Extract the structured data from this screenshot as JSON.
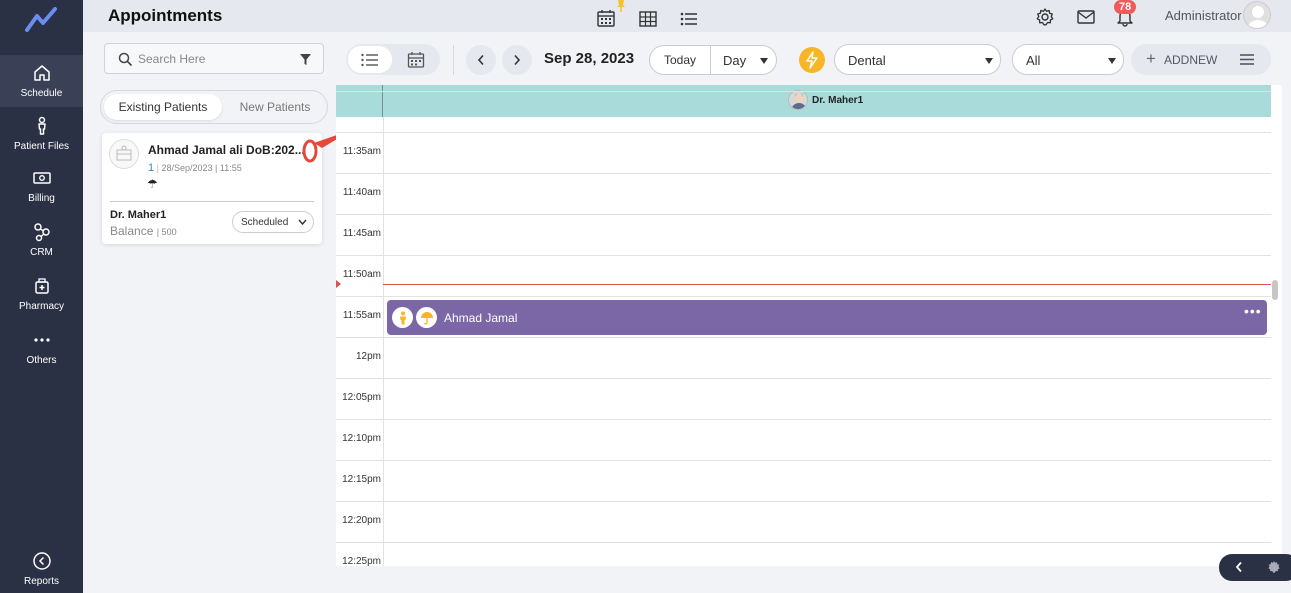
{
  "sidebar": {
    "items": [
      {
        "label": "Schedule",
        "icon": "home-icon",
        "active": true
      },
      {
        "label": "Patient Files",
        "icon": "person-icon"
      },
      {
        "label": "Billing",
        "icon": "money-icon"
      },
      {
        "label": "CRM",
        "icon": "crm-icon"
      },
      {
        "label": "Pharmacy",
        "icon": "pharmacy-icon"
      },
      {
        "label": "Others",
        "icon": "more-icon"
      }
    ],
    "reports_label": "Reports"
  },
  "header": {
    "title": "Appointments",
    "notification_count": "78",
    "user_name": "Administrator"
  },
  "left_panel": {
    "search_placeholder": "Search Here",
    "tabs": [
      "Existing Patients",
      "New Patients"
    ],
    "card": {
      "patient_name": "Ahmad Jamal ali DoB:202...",
      "number": "1",
      "datetime": "28/Sep/2023 | 11:55",
      "umbrella": "☂",
      "doctor": "Dr. Maher1",
      "balance_label": "Balance",
      "balance_amount": "| 500",
      "status": "Scheduled"
    }
  },
  "toolbar": {
    "date": "Sep 28, 2023",
    "today_label": "Today",
    "view_select": "Day",
    "department": "Dental",
    "filter": "All",
    "addnew_label": "ADDNEW"
  },
  "calendar": {
    "doctor_name": "Dr. Maher1",
    "times": [
      "11:35am",
      "11:40am",
      "11:45am",
      "11:50am",
      "11:55am",
      "12pm",
      "12:05pm",
      "12:10pm",
      "12:15pm",
      "12:20pm",
      "12:25pm"
    ],
    "appointment": {
      "patient": "Ahmad Jamal",
      "more": "•••"
    }
  },
  "colors": {
    "sidebar_bg": "#2b3145",
    "header_bg": "#e6e8ef",
    "calendar_header": "#a8dbd9",
    "appointment": "#7b67a6",
    "now_line": "#d9534f",
    "accent_yellow": "#f7b527",
    "annotation_red": "#e5483b"
  }
}
